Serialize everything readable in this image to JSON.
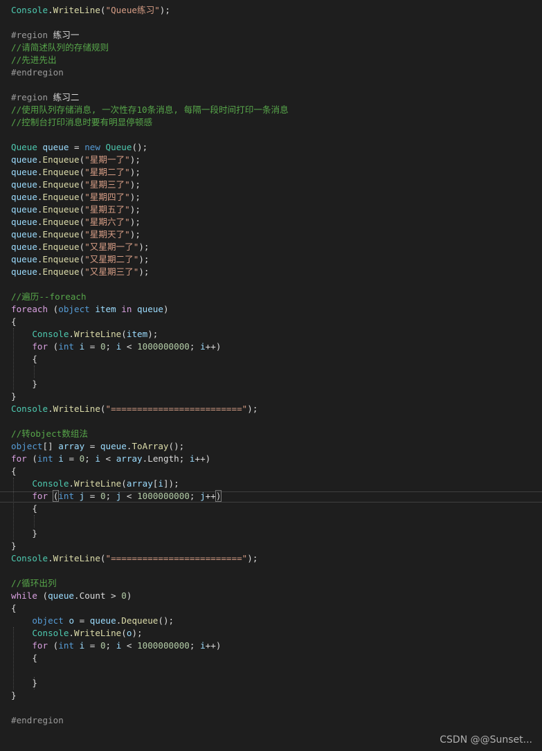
{
  "colors": {
    "background": "#1e1e1e",
    "keyword": "#569cd6",
    "control": "#d8a0df",
    "type": "#4ec9b0",
    "method": "#dcdcaa",
    "variable": "#9cdcfe",
    "string": "#d69d85",
    "comment": "#57a64a",
    "number": "#b5cea8",
    "preprocessor": "#9b9b9b",
    "plain": "#dcdcdc"
  },
  "code_lines": [
    [
      [
        "type",
        "Console"
      ],
      [
        "p",
        "."
      ],
      [
        "method",
        "WriteLine"
      ],
      [
        "p",
        "("
      ],
      [
        "string",
        "\"Queue练习\""
      ],
      [
        "p",
        ");"
      ]
    ],
    [],
    [
      [
        "pre",
        "#region "
      ],
      [
        "p",
        "练习一"
      ]
    ],
    [
      [
        "comment",
        "//请简述队列的存储规则"
      ]
    ],
    [
      [
        "comment",
        "//先进先出"
      ]
    ],
    [
      [
        "pre",
        "#endregion"
      ]
    ],
    [],
    [
      [
        "pre",
        "#region "
      ],
      [
        "p",
        "练习二"
      ]
    ],
    [
      [
        "comment",
        "//使用队列存储消息, 一次性存10条消息, 每隔一段时间打印一条消息"
      ]
    ],
    [
      [
        "comment",
        "//控制台打印消息时要有明显停顿感"
      ]
    ],
    [],
    [
      [
        "type",
        "Queue"
      ],
      [
        "p",
        " "
      ],
      [
        "var",
        "queue"
      ],
      [
        "p",
        " = "
      ],
      [
        "kw",
        "new"
      ],
      [
        "p",
        " "
      ],
      [
        "type",
        "Queue"
      ],
      [
        "p",
        "();"
      ]
    ],
    [
      [
        "var",
        "queue"
      ],
      [
        "p",
        "."
      ],
      [
        "method",
        "Enqueue"
      ],
      [
        "p",
        "("
      ],
      [
        "string",
        "\"星期一了\""
      ],
      [
        "p",
        ");"
      ]
    ],
    [
      [
        "var",
        "queue"
      ],
      [
        "p",
        "."
      ],
      [
        "method",
        "Enqueue"
      ],
      [
        "p",
        "("
      ],
      [
        "string",
        "\"星期二了\""
      ],
      [
        "p",
        ");"
      ]
    ],
    [
      [
        "var",
        "queue"
      ],
      [
        "p",
        "."
      ],
      [
        "method",
        "Enqueue"
      ],
      [
        "p",
        "("
      ],
      [
        "string",
        "\"星期三了\""
      ],
      [
        "p",
        ");"
      ]
    ],
    [
      [
        "var",
        "queue"
      ],
      [
        "p",
        "."
      ],
      [
        "method",
        "Enqueue"
      ],
      [
        "p",
        "("
      ],
      [
        "string",
        "\"星期四了\""
      ],
      [
        "p",
        ");"
      ]
    ],
    [
      [
        "var",
        "queue"
      ],
      [
        "p",
        "."
      ],
      [
        "method",
        "Enqueue"
      ],
      [
        "p",
        "("
      ],
      [
        "string",
        "\"星期五了\""
      ],
      [
        "p",
        ");"
      ]
    ],
    [
      [
        "var",
        "queue"
      ],
      [
        "p",
        "."
      ],
      [
        "method",
        "Enqueue"
      ],
      [
        "p",
        "("
      ],
      [
        "string",
        "\"星期六了\""
      ],
      [
        "p",
        ");"
      ]
    ],
    [
      [
        "var",
        "queue"
      ],
      [
        "p",
        "."
      ],
      [
        "method",
        "Enqueue"
      ],
      [
        "p",
        "("
      ],
      [
        "string",
        "\"星期天了\""
      ],
      [
        "p",
        ");"
      ]
    ],
    [
      [
        "var",
        "queue"
      ],
      [
        "p",
        "."
      ],
      [
        "method",
        "Enqueue"
      ],
      [
        "p",
        "("
      ],
      [
        "string",
        "\"又星期一了\""
      ],
      [
        "p",
        ");"
      ]
    ],
    [
      [
        "var",
        "queue"
      ],
      [
        "p",
        "."
      ],
      [
        "method",
        "Enqueue"
      ],
      [
        "p",
        "("
      ],
      [
        "string",
        "\"又星期二了\""
      ],
      [
        "p",
        ");"
      ]
    ],
    [
      [
        "var",
        "queue"
      ],
      [
        "p",
        "."
      ],
      [
        "method",
        "Enqueue"
      ],
      [
        "p",
        "("
      ],
      [
        "string",
        "\"又星期三了\""
      ],
      [
        "p",
        ");"
      ]
    ],
    [],
    [
      [
        "comment",
        "//遍历--foreach"
      ]
    ],
    [
      [
        "ctrl",
        "foreach"
      ],
      [
        "p",
        " ("
      ],
      [
        "kw",
        "object"
      ],
      [
        "p",
        " "
      ],
      [
        "var",
        "item"
      ],
      [
        "p",
        " "
      ],
      [
        "ctrl",
        "in"
      ],
      [
        "p",
        " "
      ],
      [
        "var",
        "queue"
      ],
      [
        "p",
        ")"
      ]
    ],
    [
      [
        "p",
        "{"
      ]
    ],
    [
      [
        "p",
        "    "
      ],
      [
        "type",
        "Console"
      ],
      [
        "p",
        "."
      ],
      [
        "method",
        "WriteLine"
      ],
      [
        "p",
        "("
      ],
      [
        "var",
        "item"
      ],
      [
        "p",
        ");"
      ]
    ],
    [
      [
        "p",
        "    "
      ],
      [
        "ctrl",
        "for"
      ],
      [
        "p",
        " ("
      ],
      [
        "kw",
        "int"
      ],
      [
        "p",
        " "
      ],
      [
        "var",
        "i"
      ],
      [
        "p",
        " = "
      ],
      [
        "num",
        "0"
      ],
      [
        "p",
        "; "
      ],
      [
        "var",
        "i"
      ],
      [
        "p",
        " < "
      ],
      [
        "num",
        "1000000000"
      ],
      [
        "p",
        "; "
      ],
      [
        "var",
        "i"
      ],
      [
        "p",
        "++)"
      ]
    ],
    [
      [
        "p",
        "    {"
      ]
    ],
    [],
    [
      [
        "p",
        "    }"
      ]
    ],
    [
      [
        "p",
        "}"
      ]
    ],
    [
      [
        "type",
        "Console"
      ],
      [
        "p",
        "."
      ],
      [
        "method",
        "WriteLine"
      ],
      [
        "p",
        "("
      ],
      [
        "string",
        "\"=========================\""
      ],
      [
        "p",
        ");"
      ]
    ],
    [],
    [
      [
        "comment",
        "//转object数组法"
      ]
    ],
    [
      [
        "kw",
        "object"
      ],
      [
        "p",
        "[] "
      ],
      [
        "var",
        "array"
      ],
      [
        "p",
        " = "
      ],
      [
        "var",
        "queue"
      ],
      [
        "p",
        "."
      ],
      [
        "method",
        "ToArray"
      ],
      [
        "p",
        "();"
      ]
    ],
    [
      [
        "ctrl",
        "for"
      ],
      [
        "p",
        " ("
      ],
      [
        "kw",
        "int"
      ],
      [
        "p",
        " "
      ],
      [
        "var",
        "i"
      ],
      [
        "p",
        " = "
      ],
      [
        "num",
        "0"
      ],
      [
        "p",
        "; "
      ],
      [
        "var",
        "i"
      ],
      [
        "p",
        " < "
      ],
      [
        "var",
        "array"
      ],
      [
        "p",
        "."
      ],
      [
        "p",
        "Length"
      ],
      [
        "p",
        "; "
      ],
      [
        "var",
        "i"
      ],
      [
        "p",
        "++)"
      ]
    ],
    [
      [
        "p",
        "{"
      ]
    ],
    [
      [
        "p",
        "    "
      ],
      [
        "type",
        "Console"
      ],
      [
        "p",
        "."
      ],
      [
        "method",
        "WriteLine"
      ],
      [
        "p",
        "("
      ],
      [
        "var",
        "array"
      ],
      [
        "p",
        "["
      ],
      [
        "var",
        "i"
      ],
      [
        "p",
        "]);"
      ]
    ],
    [
      [
        "p",
        "    "
      ],
      [
        "ctrl",
        "for"
      ],
      [
        "p",
        " "
      ],
      [
        "match",
        "("
      ],
      [
        "kw",
        "int"
      ],
      [
        "p",
        " "
      ],
      [
        "var",
        "j"
      ],
      [
        "p",
        " = "
      ],
      [
        "num",
        "0"
      ],
      [
        "p",
        "; "
      ],
      [
        "var",
        "j"
      ],
      [
        "p",
        " < "
      ],
      [
        "num",
        "1000000000"
      ],
      [
        "p",
        "; "
      ],
      [
        "var",
        "j"
      ],
      [
        "p",
        "++"
      ],
      [
        "match",
        ")"
      ]
    ],
    [
      [
        "p",
        "    {"
      ]
    ],
    [],
    [
      [
        "p",
        "    }"
      ]
    ],
    [
      [
        "p",
        "}"
      ]
    ],
    [
      [
        "type",
        "Console"
      ],
      [
        "p",
        "."
      ],
      [
        "method",
        "WriteLine"
      ],
      [
        "p",
        "("
      ],
      [
        "string",
        "\"=========================\""
      ],
      [
        "p",
        ");"
      ]
    ],
    [],
    [
      [
        "comment",
        "//循环出列"
      ]
    ],
    [
      [
        "ctrl",
        "while"
      ],
      [
        "p",
        " ("
      ],
      [
        "var",
        "queue"
      ],
      [
        "p",
        "."
      ],
      [
        "p",
        "Count"
      ],
      [
        "p",
        " > "
      ],
      [
        "num",
        "0"
      ],
      [
        "p",
        ")"
      ]
    ],
    [
      [
        "p",
        "{"
      ]
    ],
    [
      [
        "p",
        "    "
      ],
      [
        "kw",
        "object"
      ],
      [
        "p",
        " "
      ],
      [
        "var",
        "o"
      ],
      [
        "p",
        " = "
      ],
      [
        "var",
        "queue"
      ],
      [
        "p",
        "."
      ],
      [
        "method",
        "Dequeue"
      ],
      [
        "p",
        "();"
      ]
    ],
    [
      [
        "p",
        "    "
      ],
      [
        "type",
        "Console"
      ],
      [
        "p",
        "."
      ],
      [
        "method",
        "WriteLine"
      ],
      [
        "p",
        "("
      ],
      [
        "var",
        "o"
      ],
      [
        "p",
        ");"
      ]
    ],
    [
      [
        "p",
        "    "
      ],
      [
        "ctrl",
        "for"
      ],
      [
        "p",
        " ("
      ],
      [
        "kw",
        "int"
      ],
      [
        "p",
        " "
      ],
      [
        "var",
        "i"
      ],
      [
        "p",
        " = "
      ],
      [
        "num",
        "0"
      ],
      [
        "p",
        "; "
      ],
      [
        "var",
        "i"
      ],
      [
        "p",
        " < "
      ],
      [
        "num",
        "1000000000"
      ],
      [
        "p",
        "; "
      ],
      [
        "var",
        "i"
      ],
      [
        "p",
        "++)"
      ]
    ],
    [
      [
        "p",
        "    {"
      ]
    ],
    [],
    [
      [
        "p",
        "    }"
      ]
    ],
    [
      [
        "p",
        "}"
      ]
    ],
    [],
    [
      [
        "pre",
        "#endregion"
      ]
    ]
  ],
  "watermark": "CSDN @@Sunset..."
}
